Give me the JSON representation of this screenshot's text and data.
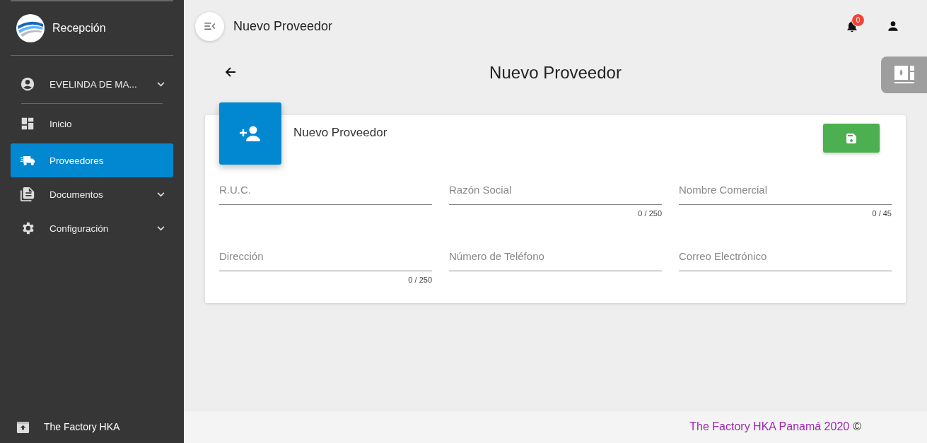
{
  "sidebar": {
    "brand": "Recepción",
    "items": [
      {
        "kind": "user",
        "label": "EVELINDA DE MA...",
        "selected": false,
        "expandable": true
      },
      {
        "kind": "link",
        "label": "Inicio",
        "selected": false,
        "expandable": false
      },
      {
        "kind": "link",
        "label": "Proveedores",
        "selected": true,
        "expandable": false
      },
      {
        "kind": "link",
        "label": "Documentos",
        "selected": false,
        "expandable": true
      },
      {
        "kind": "link",
        "label": "Configuración",
        "selected": false,
        "expandable": true
      }
    ],
    "footer": "The Factory HKA"
  },
  "topbar": {
    "title": "Nuevo Proveedor",
    "notification_count": "0"
  },
  "page": {
    "title": "Nuevo Proveedor"
  },
  "card": {
    "title": "Nuevo Proveedor",
    "fields": [
      {
        "placeholder": "R.U.C."
      },
      {
        "placeholder": "Razón Social",
        "counter": "0 / 250"
      },
      {
        "placeholder": "Nombre Comercial",
        "counter": "0 / 45"
      },
      {
        "placeholder": "Dirección",
        "counter": "0 / 250"
      },
      {
        "placeholder": "Número de Teléfono"
      },
      {
        "placeholder": "Correo Electrónico"
      }
    ]
  },
  "footer": {
    "text": "The Factory HKA Panamá 2020",
    "symbol": "©"
  }
}
